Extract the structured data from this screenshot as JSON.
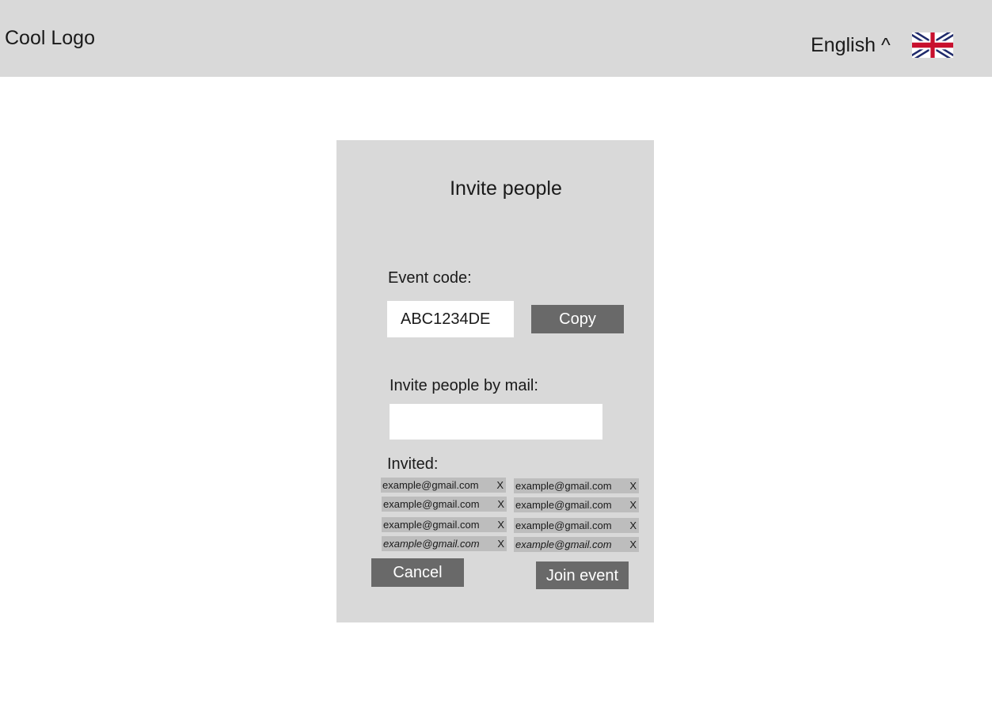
{
  "header": {
    "logo_text": "Cool Logo",
    "language_label": "English ^",
    "flag_icon": "uk-flag-icon"
  },
  "dialog": {
    "title": "Invite people",
    "event_code_label": "Event code:",
    "event_code_value": "ABC1234DE",
    "copy_label": "Copy",
    "invite_mail_label": "Invite people by mail:",
    "invite_mail_value": "",
    "invited_label": "Invited:",
    "invited": [
      {
        "email": "example@gmail.com",
        "remove": "X"
      },
      {
        "email": "example@gmail.com",
        "remove": "X"
      },
      {
        "email": "example@gmail.com",
        "remove": "X"
      },
      {
        "email": "example@gmail.com",
        "remove": "X"
      },
      {
        "email": "example@gmail.com",
        "remove": "X"
      },
      {
        "email": "example@gmail.com",
        "remove": "X"
      },
      {
        "email": "example@gmail.com",
        "remove": "X"
      },
      {
        "email": "example@gmail.com",
        "remove": "X"
      }
    ],
    "cancel_label": "Cancel",
    "join_label": "Join event"
  },
  "colors": {
    "header_bg": "#d9d9d9",
    "panel_bg": "#d9d9d9",
    "button_bg": "#696969",
    "chip_bg": "#bdbdbd",
    "button_text": "#ffffff"
  }
}
